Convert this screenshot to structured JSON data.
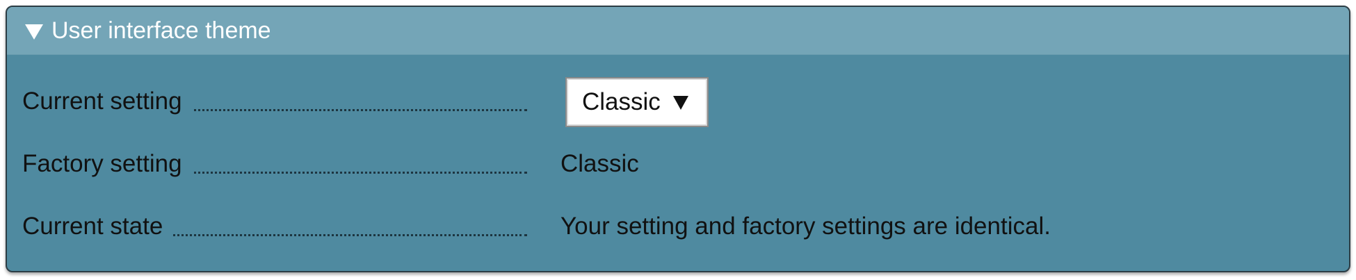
{
  "panel": {
    "title": "User interface theme",
    "collapse_icon": "triangle-down-icon"
  },
  "rows": [
    {
      "label": "Current setting"
    },
    {
      "label": "Factory setting",
      "value": "Classic"
    },
    {
      "label": "Current state",
      "value": "Your setting and factory settings are identical."
    }
  ],
  "theme_select": {
    "selected": "Classic",
    "arrow_icon": "triangle-down-icon"
  },
  "colors": {
    "panel_bg": "#4f8aa0",
    "header_bg": "#74a5b7",
    "text": "#111111",
    "title_text": "#ffffff"
  }
}
